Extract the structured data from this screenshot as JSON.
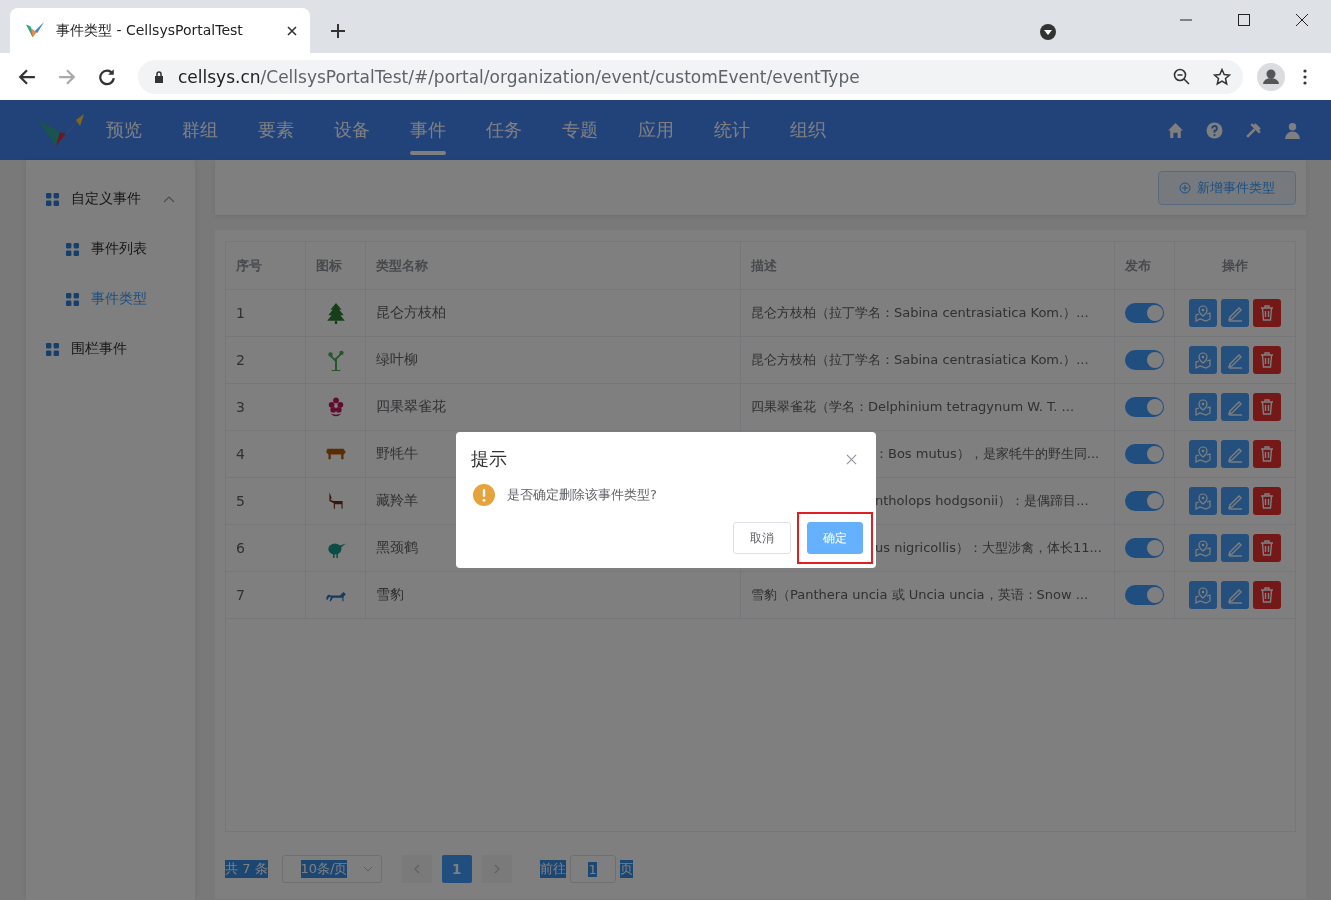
{
  "browser": {
    "tab_title": "事件类型 - CellsysPortalTest",
    "url_host": "cellsys.cn",
    "url_path": "/CellsysPortalTest/#/portal/organization/event/customEvent/eventType"
  },
  "nav": {
    "items": [
      {
        "label": "预览",
        "selected": false
      },
      {
        "label": "群组",
        "selected": false
      },
      {
        "label": "要素",
        "selected": false
      },
      {
        "label": "设备",
        "selected": false
      },
      {
        "label": "事件",
        "selected": true
      },
      {
        "label": "任务",
        "selected": false
      },
      {
        "label": "专题",
        "selected": false
      },
      {
        "label": "应用",
        "selected": false
      },
      {
        "label": "统计",
        "selected": false
      },
      {
        "label": "组织",
        "selected": false
      }
    ]
  },
  "sidebar": {
    "items": [
      {
        "label": "自定义事件",
        "selected": false,
        "expanded": true,
        "children": [
          {
            "label": "事件列表",
            "selected": false
          },
          {
            "label": "事件类型",
            "selected": true
          }
        ]
      },
      {
        "label": "围栏事件",
        "selected": false
      }
    ]
  },
  "toolbar": {
    "add_button": "新增事件类型"
  },
  "table": {
    "columns": [
      "序号",
      "图标",
      "类型名称",
      "描述",
      "发布",
      "操作"
    ],
    "rows": [
      {
        "index": "1",
        "name": "昆仑方枝柏",
        "description": "昆仑方枝柏（拉丁学名：Sabina centrasiatica Kom.）...",
        "published": true,
        "covered": false
      },
      {
        "index": "2",
        "name": "绿叶柳",
        "description": "昆仑方枝柏（拉丁学名：Sabina centrasiatica Kom.）...",
        "published": true,
        "covered": false
      },
      {
        "index": "3",
        "name": "四果翠雀花",
        "description": "四果翠雀花（学名：Delphinium tetragynum W. T. ...",
        "published": true,
        "covered": false
      },
      {
        "index": "4",
        "name": "野牦牛",
        "description": "：Bos mutus），是家牦牛的野生同...",
        "published": true,
        "covered": true
      },
      {
        "index": "5",
        "name": "藏羚羊",
        "description": "ntholops hodgsonii）：是偶蹄目...",
        "published": true,
        "covered": true
      },
      {
        "index": "6",
        "name": "黑颈鹤",
        "description": "us nigricollis）：大型涉禽，体长11...",
        "published": true,
        "covered": true
      },
      {
        "index": "7",
        "name": "雪豹",
        "description": "雪豹（Panthera uncia 或 Uncia uncia，英语：Snow ...",
        "published": true,
        "covered": false
      }
    ]
  },
  "pagination": {
    "total": "共 7 条",
    "page_size": "10条/页",
    "pages": [
      {
        "label": "1",
        "selected": true
      }
    ],
    "goto_label": "前往",
    "goto_value": "1",
    "page_suffix": "页"
  },
  "dialog": {
    "title": "提示",
    "message": "是否确定删除该事件类型?",
    "cancel": "取消",
    "confirm": "确定",
    "confirm_annotated": true
  }
}
